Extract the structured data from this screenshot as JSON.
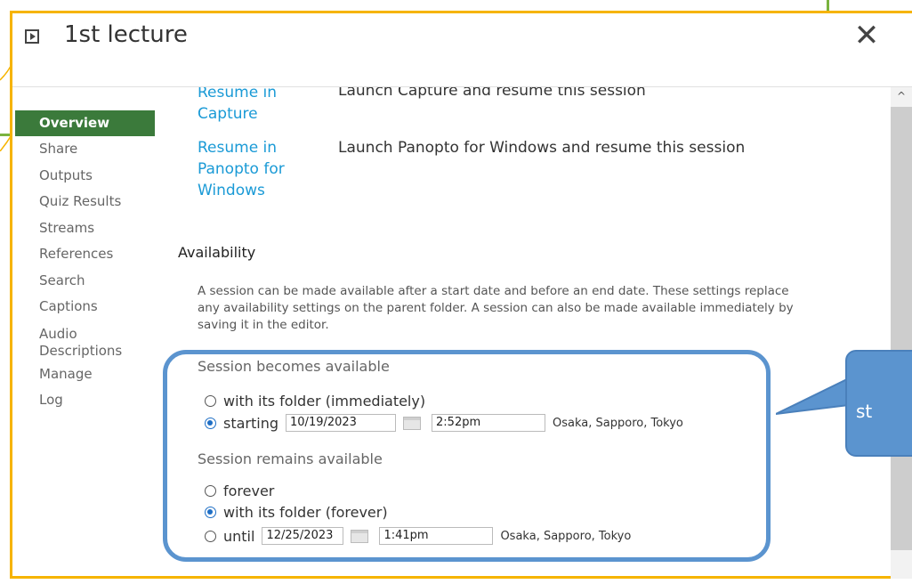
{
  "dialog": {
    "title": "1st lecture"
  },
  "nav": {
    "items": [
      {
        "label": "Overview",
        "selected": true
      },
      {
        "label": "Share"
      },
      {
        "label": "Outputs"
      },
      {
        "label": "Quiz Results"
      },
      {
        "label": "Streams"
      },
      {
        "label": "References"
      },
      {
        "label": "Search"
      },
      {
        "label": "Captions"
      },
      {
        "label": "Audio Descriptions"
      },
      {
        "label": "Manage"
      },
      {
        "label": "Log"
      }
    ]
  },
  "launch": {
    "capture": {
      "link": "Resume in Capture",
      "desc": "Launch Capture and resume this session"
    },
    "windows": {
      "link": "Resume in Panopto for Windows",
      "desc": "Launch Panopto for Windows and resume this session"
    }
  },
  "availability": {
    "heading": "Availability",
    "description": "A session can be made available after a start date and before an end date. These settings replace any availability settings on the parent folder. A session can also be made available immediately by saving it in the editor.",
    "becomes": {
      "label": "Session becomes available",
      "option_folder": "with its folder (immediately)",
      "option_starting": "starting",
      "start_date": "10/19/2023",
      "start_time": "2:52pm",
      "timezone": "Osaka, Sapporo, Tokyo"
    },
    "remains": {
      "label": "Session remains available",
      "option_forever": "forever",
      "option_folder": "with its folder (forever)",
      "option_until": "until",
      "end_date": "12/25/2023",
      "end_time": "1:41pm",
      "timezone": "Osaka, Sapporo, Tokyo"
    }
  },
  "callout": {
    "text": "st"
  },
  "colors": {
    "accent_green": "#3b7a3b",
    "link_blue": "#1a9ad6",
    "callout_blue": "#5b94cf",
    "frame_yellow": "#f6b400"
  }
}
